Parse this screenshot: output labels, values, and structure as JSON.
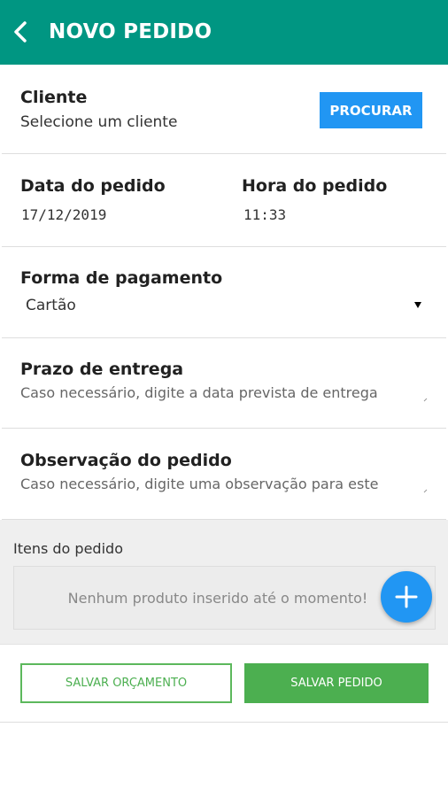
{
  "appbar": {
    "title": "NOVO PEDIDO",
    "back_icon": "chevron-left-icon",
    "color": "#009682"
  },
  "cliente": {
    "label": "Cliente",
    "value": "Selecione um cliente",
    "button": "PROCURAR"
  },
  "data_pedido": {
    "label": "Data do pedido",
    "value": "17/12/2019"
  },
  "hora_pedido": {
    "label": "Hora do pedido",
    "value": "11:33"
  },
  "pagamento": {
    "label": "Forma de pagamento",
    "selected": "Cartão"
  },
  "prazo": {
    "label": "Prazo de entrega",
    "placeholder": "Caso necessário, digite a data prevista de entrega"
  },
  "observacao": {
    "label": "Observação do pedido",
    "placeholder": "Caso necessário, digite uma observação para este"
  },
  "itens": {
    "title": "Itens do pedido",
    "empty_message": "Nenhum produto inserido até o momento!",
    "add_icon": "plus-icon"
  },
  "footer": {
    "save_quote": "SALVAR ORÇAMENTO",
    "save_order": "SALVAR PEDIDO"
  },
  "colors": {
    "primary": "#009682",
    "accent_blue": "#2196f3",
    "green": "#4caf50"
  }
}
